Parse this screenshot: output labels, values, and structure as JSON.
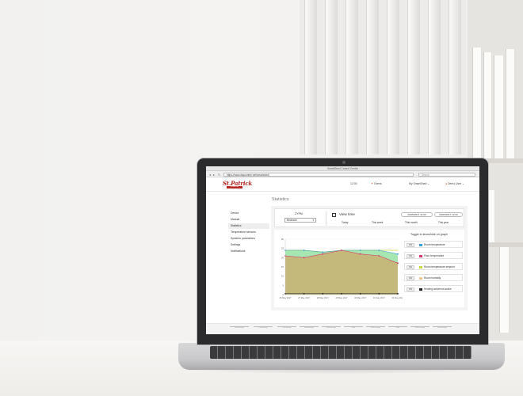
{
  "browser": {
    "title": "SmartShed Control Center",
    "url": "https://www.dsqcontrol.net/smartshed/",
    "search_placeholder": "Search"
  },
  "header": {
    "logo_word": "St.Patrick",
    "logo_ribbon": "LOGGING",
    "time": "12:00",
    "alerts_label": "Ovens",
    "account_label": "My SmartShed",
    "user_label": "Demo User"
  },
  "sidebar": {
    "items": [
      {
        "label": "Device"
      },
      {
        "label": "Manual"
      },
      {
        "label": "Statistics"
      },
      {
        "label": "Temperature sensors"
      },
      {
        "label": "Systems parameters"
      },
      {
        "label": "Settings"
      },
      {
        "label": "Notifications"
      }
    ],
    "active_index": 2
  },
  "page": {
    "title": "Statistics",
    "sensor_label": "ZYPM",
    "sensor_value": "Bedroom",
    "view_time_label": "View time",
    "date_from": "00/05/2017 11:00",
    "date_to": "03/05/2017 12:00",
    "range_tabs": [
      "Today",
      "This week",
      "This month",
      "This year"
    ]
  },
  "toggles": {
    "title": "Toggle to show/hide on graph",
    "items": [
      {
        "state": "ON",
        "label": "Room temperature",
        "color": "#3aa0dc"
      },
      {
        "state": "ON",
        "label": "Floor temperature",
        "color": "#d9336e"
      },
      {
        "state": "ON",
        "label": "Room temperature setpoint",
        "color": "#c7d83a"
      },
      {
        "state": "ON",
        "label": "Room humidity",
        "color": "#f2c48e"
      },
      {
        "state": "ON",
        "label": "Heating active/not active",
        "color": "#222222"
      }
    ]
  },
  "chart_data": {
    "type": "area",
    "categories": [
      "26 May 2017",
      "27 May 2017",
      "28 May 2017",
      "29 May 2017",
      "30 May 2017",
      "31 May 2017",
      "01 May 2017"
    ],
    "ylim": [
      0,
      30
    ],
    "yticks": [
      0,
      5,
      10,
      15,
      20,
      25,
      30
    ],
    "grid": true,
    "legend": "right",
    "series": [
      {
        "name": "Room temperature",
        "color": "#3aa0dc",
        "fill": "#9be3a8",
        "values": [
          24,
          24,
          23,
          24,
          24,
          24,
          22
        ]
      },
      {
        "name": "Floor temperature",
        "color": "#d9336e",
        "fill": "#c8b476",
        "values": [
          21,
          20,
          22,
          24,
          22,
          21,
          17
        ]
      },
      {
        "name": "Heating active/not active",
        "color": "#222222",
        "fill": "none",
        "values": [
          0.5,
          0.5,
          0.5,
          0.5,
          0.5,
          0.5,
          0.5
        ]
      }
    ],
    "setpoint": {
      "name": "Room temperature setpoint",
      "color": "#c7d83a",
      "values": [
        24,
        24,
        23,
        24,
        24,
        24,
        24
      ]
    }
  },
  "footer": {
    "items": [
      "Shed Energy",
      "Leaf Energy",
      "Leaf Energy",
      "Heat Energy",
      "Heat Energy",
      "Floor",
      "Floor Energy",
      "Floor",
      "Floor Energy",
      "Floor Energy"
    ]
  }
}
